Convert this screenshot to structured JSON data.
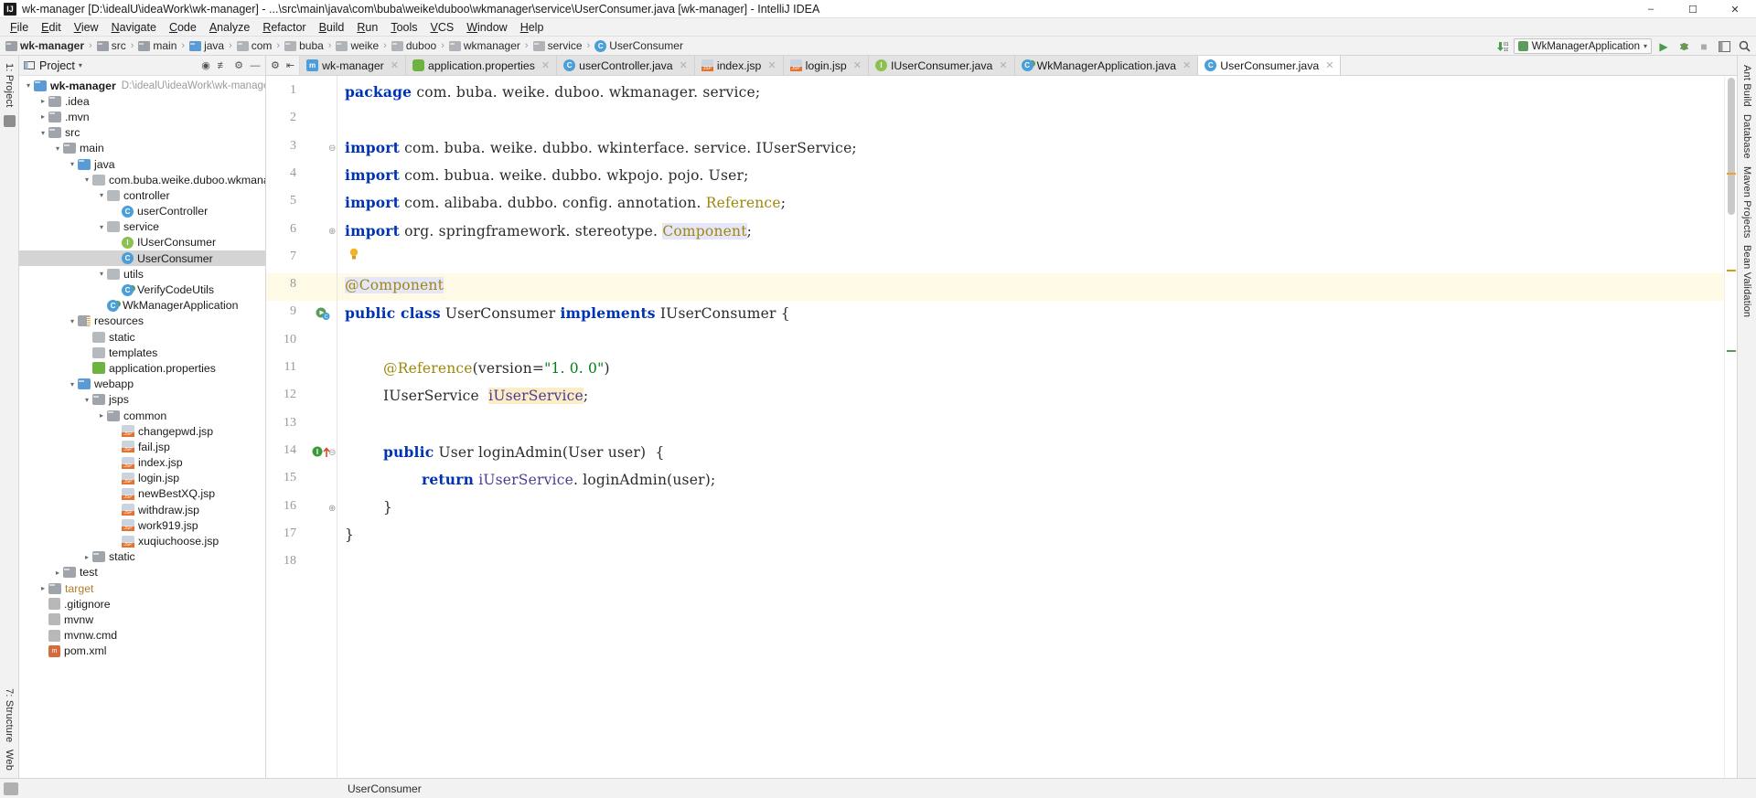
{
  "window": {
    "title": "wk-manager [D:\\idealU\\ideaWork\\wk-manager] - ...\\src\\main\\java\\com\\buba\\weike\\duboo\\wkmanager\\service\\UserConsumer.java [wk-manager] - IntelliJ IDEA",
    "logo": "IJ",
    "minimize": "–",
    "maximize": "☐",
    "close": "✕"
  },
  "menu": [
    "File",
    "Edit",
    "View",
    "Navigate",
    "Code",
    "Analyze",
    "Refactor",
    "Build",
    "Run",
    "Tools",
    "VCS",
    "Window",
    "Help"
  ],
  "breadcrumb": [
    {
      "label": "wk-manager",
      "icon": "module-icon",
      "bold": true
    },
    {
      "label": "src",
      "icon": "folder-icon",
      "bold": false
    },
    {
      "label": "main",
      "icon": "folder-icon",
      "bold": false
    },
    {
      "label": "java",
      "icon": "source-folder-icon",
      "bold": false
    },
    {
      "label": "com",
      "icon": "package-icon",
      "bold": false
    },
    {
      "label": "buba",
      "icon": "package-icon",
      "bold": false
    },
    {
      "label": "weike",
      "icon": "package-icon",
      "bold": false
    },
    {
      "label": "duboo",
      "icon": "package-icon",
      "bold": false
    },
    {
      "label": "wkmanager",
      "icon": "package-icon",
      "bold": false
    },
    {
      "label": "service",
      "icon": "package-icon",
      "bold": false
    },
    {
      "label": "UserConsumer",
      "icon": "class-icon",
      "bold": false
    }
  ],
  "toolbar": {
    "update_icon": "update-project-icon",
    "run_config": "WkManagerApplication",
    "run_config_icon": "spring-boot-icon",
    "dropdown_icon": "chevron-down-icon",
    "run": "▶",
    "debug": "debug-icon",
    "stop": "■",
    "layout": "layout-icon",
    "search": "search-icon"
  },
  "project_panel": {
    "title": "Project",
    "dropdown_icon": "chevron-down-icon",
    "collapse_icon": "collapse-all-icon",
    "target_icon": "scroll-from-source-icon",
    "settings_icon": "gear-icon",
    "hide_icon": "hide-icon",
    "tree": [
      {
        "depth": 0,
        "arrow": "open",
        "icon": "module",
        "label": "wk-manager",
        "bold": true,
        "path": "D:\\idealU\\ideaWork\\wk-manager"
      },
      {
        "depth": 1,
        "arrow": "closed",
        "icon": "folder",
        "label": ".idea"
      },
      {
        "depth": 1,
        "arrow": "closed",
        "icon": "folder",
        "label": ".mvn"
      },
      {
        "depth": 1,
        "arrow": "open",
        "icon": "folder",
        "label": "src"
      },
      {
        "depth": 2,
        "arrow": "open",
        "icon": "folder",
        "label": "main"
      },
      {
        "depth": 3,
        "arrow": "open",
        "icon": "fblue",
        "label": "java"
      },
      {
        "depth": 4,
        "arrow": "open",
        "icon": "package",
        "label": "com.buba.weike.duboo.wkmanager"
      },
      {
        "depth": 5,
        "arrow": "open",
        "icon": "package",
        "label": "controller"
      },
      {
        "depth": 6,
        "arrow": "none",
        "icon": "class",
        "label": "userController"
      },
      {
        "depth": 5,
        "arrow": "open",
        "icon": "package",
        "label": "service"
      },
      {
        "depth": 6,
        "arrow": "none",
        "icon": "interface",
        "label": "IUserConsumer"
      },
      {
        "depth": 6,
        "arrow": "none",
        "icon": "class",
        "label": "UserConsumer",
        "selected": true
      },
      {
        "depth": 5,
        "arrow": "open",
        "icon": "package",
        "label": "utils"
      },
      {
        "depth": 6,
        "arrow": "none",
        "icon": "classrun",
        "label": "VerifyCodeUtils"
      },
      {
        "depth": 5,
        "arrow": "none",
        "icon": "classrun",
        "label": "WkManagerApplication"
      },
      {
        "depth": 3,
        "arrow": "open",
        "icon": "resources",
        "label": "resources"
      },
      {
        "depth": 4,
        "arrow": "none",
        "icon": "package",
        "label": "static"
      },
      {
        "depth": 4,
        "arrow": "none",
        "icon": "package",
        "label": "templates"
      },
      {
        "depth": 4,
        "arrow": "none",
        "icon": "spring",
        "label": "application.properties"
      },
      {
        "depth": 3,
        "arrow": "open",
        "icon": "fblue",
        "label": "webapp"
      },
      {
        "depth": 4,
        "arrow": "open",
        "icon": "folder",
        "label": "jsps"
      },
      {
        "depth": 5,
        "arrow": "closed",
        "icon": "folder",
        "label": "common"
      },
      {
        "depth": 6,
        "arrow": "none",
        "icon": "jsp",
        "label": "changepwd.jsp"
      },
      {
        "depth": 6,
        "arrow": "none",
        "icon": "jsp",
        "label": "fail.jsp"
      },
      {
        "depth": 6,
        "arrow": "none",
        "icon": "jsp",
        "label": "index.jsp"
      },
      {
        "depth": 6,
        "arrow": "none",
        "icon": "jsp",
        "label": "login.jsp"
      },
      {
        "depth": 6,
        "arrow": "none",
        "icon": "jsp",
        "label": "newBestXQ.jsp"
      },
      {
        "depth": 6,
        "arrow": "none",
        "icon": "jsp",
        "label": "withdraw.jsp"
      },
      {
        "depth": 6,
        "arrow": "none",
        "icon": "jsp",
        "label": "work919.jsp"
      },
      {
        "depth": 6,
        "arrow": "none",
        "icon": "jsp",
        "label": "xuqiuchoose.jsp"
      },
      {
        "depth": 4,
        "arrow": "closed",
        "icon": "folder",
        "label": "static"
      },
      {
        "depth": 2,
        "arrow": "closed",
        "icon": "folder",
        "label": "test"
      },
      {
        "depth": 1,
        "arrow": "closed",
        "icon": "target",
        "label": "target",
        "orange": true
      },
      {
        "depth": 1,
        "arrow": "none",
        "icon": "git",
        "label": ".gitignore"
      },
      {
        "depth": 1,
        "arrow": "none",
        "icon": "file",
        "label": "mvnw"
      },
      {
        "depth": 1,
        "arrow": "none",
        "icon": "file",
        "label": "mvnw.cmd"
      },
      {
        "depth": 1,
        "arrow": "none",
        "icon": "xml",
        "label": "pom.xml"
      }
    ]
  },
  "editor_tabs": [
    {
      "label": "wk-manager",
      "icon": "maven-icon",
      "active": false
    },
    {
      "label": "application.properties",
      "icon": "spring-icon",
      "active": false
    },
    {
      "label": "userController.java",
      "icon": "class-icon",
      "active": false
    },
    {
      "label": "index.jsp",
      "icon": "jsp-icon",
      "active": false
    },
    {
      "label": "login.jsp",
      "icon": "jsp-icon",
      "active": false
    },
    {
      "label": "IUserConsumer.java",
      "icon": "interface-icon",
      "active": false
    },
    {
      "label": "WkManagerApplication.java",
      "icon": "spring-class-icon",
      "active": false
    },
    {
      "label": "UserConsumer.java",
      "icon": "class-icon",
      "active": true
    }
  ],
  "code": {
    "lines": [
      {
        "n": 1,
        "tokens": [
          {
            "t": "package",
            "c": "kw"
          },
          {
            "t": " com. buba. weike. duboo. wkmanager. service;",
            "c": "plain"
          }
        ]
      },
      {
        "n": 2,
        "tokens": []
      },
      {
        "n": 3,
        "fold": "start",
        "tokens": [
          {
            "t": "import",
            "c": "kw"
          },
          {
            "t": " com. buba. weike. dubbo. wkinterface. service. IUserService;",
            "c": "plain"
          }
        ]
      },
      {
        "n": 4,
        "tokens": [
          {
            "t": "import",
            "c": "kw"
          },
          {
            "t": " com. bubua. weike. dubbo. wkpojo. pojo. User;",
            "c": "plain"
          }
        ]
      },
      {
        "n": 5,
        "tokens": [
          {
            "t": "import",
            "c": "kw"
          },
          {
            "t": " com. alibaba. dubbo. config. annotation. ",
            "c": "plain"
          },
          {
            "t": "Reference",
            "c": "ann"
          },
          {
            "t": ";",
            "c": "plain"
          }
        ]
      },
      {
        "n": 6,
        "fold": "end",
        "tokens": [
          {
            "t": "import",
            "c": "kw"
          },
          {
            "t": " org. springframework. stereotype. ",
            "c": "plain"
          },
          {
            "t": "Component",
            "c": "ann hl-comp"
          },
          {
            "t": ";",
            "c": "plain"
          }
        ]
      },
      {
        "n": 7,
        "bulb": true,
        "tokens": []
      },
      {
        "n": 8,
        "highlight": true,
        "tokens": [
          {
            "t": "@Component",
            "c": "ann hl-comp"
          }
        ]
      },
      {
        "n": 9,
        "marker": "class-run-gutter",
        "tokens": [
          {
            "t": "public class",
            "c": "kw"
          },
          {
            "t": " UserConsumer ",
            "c": "plain"
          },
          {
            "t": "implements",
            "c": "kw"
          },
          {
            "t": " IUserConsumer {",
            "c": "plain"
          }
        ]
      },
      {
        "n": 10,
        "tokens": []
      },
      {
        "n": 11,
        "indent": 1,
        "tokens": [
          {
            "t": "@Reference",
            "c": "ann"
          },
          {
            "t": "(version=",
            "c": "plain"
          },
          {
            "t": "\"1. 0. 0\"",
            "c": "str"
          },
          {
            "t": ")",
            "c": "plain"
          }
        ]
      },
      {
        "n": 12,
        "indent": 1,
        "tokens": [
          {
            "t": "IUserService  ",
            "c": "plain"
          },
          {
            "t": "iUserService",
            "c": "fld hl-field"
          },
          {
            "t": ";",
            "c": "plain"
          }
        ]
      },
      {
        "n": 13,
        "tokens": []
      },
      {
        "n": 14,
        "indent": 1,
        "marker": "override-gutter",
        "fold": "start",
        "tokens": [
          {
            "t": "public",
            "c": "kw"
          },
          {
            "t": " User loginAdmin(User user)  {",
            "c": "plain"
          }
        ]
      },
      {
        "n": 15,
        "indent": 2,
        "tokens": [
          {
            "t": "return",
            "c": "kw"
          },
          {
            "t": " ",
            "c": "plain"
          },
          {
            "t": "iUserService",
            "c": "fld"
          },
          {
            "t": ". loginAdmin(user);",
            "c": "plain"
          }
        ]
      },
      {
        "n": 16,
        "indent": 1,
        "fold": "end",
        "tokens": [
          {
            "t": "}",
            "c": "plain"
          }
        ]
      },
      {
        "n": 17,
        "tokens": [
          {
            "t": "}",
            "c": "plain"
          }
        ]
      },
      {
        "n": 18,
        "tokens": []
      }
    ]
  },
  "right_rail": [
    "Ant Build",
    "Database",
    "Maven Projects",
    "Bean Validation"
  ],
  "left_rail": {
    "top": "1: Project",
    "bottom_structure": "7: Structure",
    "bottom_web": "Web"
  },
  "statusbar": {
    "text": "UserConsumer"
  },
  "colors": {
    "keyword": "#0033b3",
    "annotation": "#9e880d",
    "string": "#067d17",
    "field": "#4a3d8f",
    "selection": "#d4d4d4",
    "highlight_line": "#fffae6",
    "accent_green": "#5b9c5b"
  }
}
